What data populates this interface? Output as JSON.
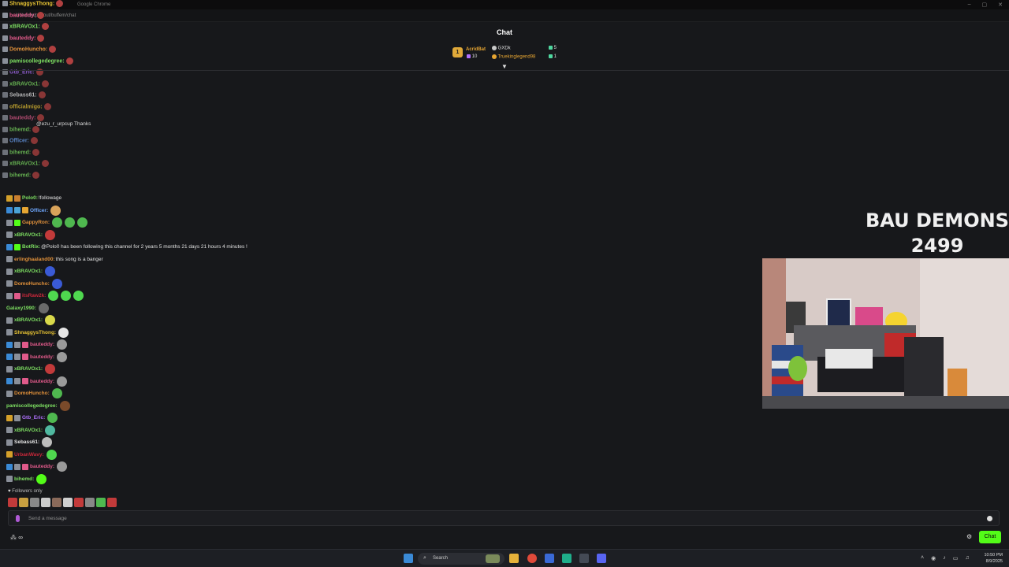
{
  "browser": {
    "app_title": "Google Chrome",
    "url": "kick.com/popout/buffem/chat"
  },
  "chat_header": {
    "title": "Chat",
    "top_gifter_rank": "1",
    "gifters": [
      {
        "name": "AcridBat",
        "count": "10",
        "color": "#e6a532"
      },
      {
        "name": "GXDk",
        "count": "5",
        "color": "#c8c8c8"
      },
      {
        "name": "Truekinglegend98",
        "count": "1",
        "color": "#e6a532"
      }
    ]
  },
  "ghost_messages": [
    {
      "name": "ShnaggysThong:",
      "color": "#e6c233"
    },
    {
      "name": "bauteddy:",
      "color": "#e05a8a"
    },
    {
      "name": "xBRAVOx1:",
      "color": "#7ee062"
    },
    {
      "name": "bauteddy:",
      "color": "#e05a8a"
    },
    {
      "name": "DomoHuncho:",
      "color": "#e0903a"
    },
    {
      "name": "pamiscollegedegree:",
      "color": "#7ee062"
    },
    {
      "name": "Gtb_Eric:",
      "color": "#b070ff"
    },
    {
      "name": "xBRAVOx1:",
      "color": "#7ee062"
    },
    {
      "name": "Sebass61:",
      "color": "#e6e6e6"
    },
    {
      "name": "officialmigo:",
      "color": "#e6c233"
    },
    {
      "name": "bauteddy:",
      "color": "#e05a8a"
    },
    {
      "name": "bihemd:",
      "color": "#7ee062"
    },
    {
      "name": "Officer:",
      "color": "#6fa8ff"
    },
    {
      "name": "bihemd:",
      "color": "#7ee062"
    },
    {
      "name": "xBRAVOx1:",
      "color": "#7ee062"
    },
    {
      "name": "bihemd:",
      "color": "#7ee062"
    }
  ],
  "ghost_thanks": "@ezu_r_urpcup Thanks",
  "messages": [
    {
      "badges": [
        "#d4a02a",
        "#c97f2f"
      ],
      "name": "Polo0:",
      "color": "#7ee062",
      "text": "!followage",
      "emotes": []
    },
    {
      "badges": [
        "#3a8ad6",
        "#4ba3d6",
        "#e6a532"
      ],
      "name": "Officer:",
      "color": "#6fa8ff",
      "text": "",
      "emotes": [
        "#d9a35a"
      ]
    },
    {
      "badges": [
        "#8a8f99",
        "#53fc18"
      ],
      "name": "GappyRon:",
      "color": "#e0903a",
      "text": "",
      "emotes": [
        "#4fb84f",
        "#4fb84f",
        "#4fb84f"
      ]
    },
    {
      "badges": [
        "#8a8f99"
      ],
      "name": "xBRAVOx1:",
      "color": "#7ee062",
      "text": "",
      "emotes": [
        "#c23a3a"
      ]
    },
    {
      "badges": [
        "#3a8ad6",
        "#53fc18"
      ],
      "name": "BotRix:",
      "color": "#7ee062",
      "text": "@Polo0 has been following this channel for 2 years 5 months 21 days 21 hours 4 minutes !",
      "emotes": []
    },
    {
      "badges": [
        "#8a8f99"
      ],
      "name": "erlinghaaland00:",
      "color": "#e0903a",
      "text": "this song is a banger",
      "emotes": []
    },
    {
      "badges": [
        "#8a8f99"
      ],
      "name": "xBRAVOx1:",
      "color": "#7ee062",
      "text": "",
      "emotes": [
        "#3a5ad6"
      ]
    },
    {
      "badges": [
        "#8a8f99"
      ],
      "name": "DomoHuncho:",
      "color": "#e0903a",
      "text": "",
      "emotes": [
        "#3a5ad6"
      ]
    },
    {
      "badges": [
        "#8a8f99",
        "#e05a8a"
      ],
      "name": "itsRaw2k:",
      "color": "#c9283a",
      "text": "",
      "emotes": [
        "#4fd84f",
        "#4fd84f",
        "#4fd84f"
      ]
    },
    {
      "badges": [],
      "name": "Galaxy1990:",
      "color": "#7ee062",
      "text": "",
      "emotes": [
        "#6a6a6a"
      ]
    },
    {
      "badges": [
        "#8a8f99"
      ],
      "name": "xBRAVOx1:",
      "color": "#7ee062",
      "text": "",
      "emotes": [
        "#d9d94a"
      ]
    },
    {
      "badges": [
        "#8a8f99"
      ],
      "name": "ShnaggysThong:",
      "color": "#e6c233",
      "text": "",
      "emotes": [
        "#e6e6e6"
      ]
    },
    {
      "badges": [
        "#3a8ad6",
        "#8a8f99",
        "#e05a8a"
      ],
      "name": "bauteddy:",
      "color": "#e05a8a",
      "text": "",
      "emotes": [
        "#9a9a9a"
      ]
    },
    {
      "badges": [
        "#3a8ad6",
        "#8a8f99",
        "#e05a8a"
      ],
      "name": "bauteddy:",
      "color": "#e05a8a",
      "text": "",
      "emotes": [
        "#9a9a9a"
      ]
    },
    {
      "badges": [
        "#8a8f99"
      ],
      "name": "xBRAVOx1:",
      "color": "#7ee062",
      "text": "",
      "emotes": [
        "#c23a3a"
      ]
    },
    {
      "badges": [
        "#3a8ad6",
        "#8a8f99",
        "#e05a8a"
      ],
      "name": "bauteddy:",
      "color": "#e05a8a",
      "text": "",
      "emotes": [
        "#9a9a9a"
      ]
    },
    {
      "badges": [
        "#8a8f99"
      ],
      "name": "DomoHuncho:",
      "color": "#e0903a",
      "text": "",
      "emotes": [
        "#4fb84f"
      ]
    },
    {
      "badges": [],
      "name": "pamiscollegedegree:",
      "color": "#7ee062",
      "text": "",
      "emotes": [
        "#7a4a2a"
      ]
    },
    {
      "badges": [
        "#d4a02a",
        "#8a8f99"
      ],
      "name": "Gtb_Eric:",
      "color": "#b070ff",
      "text": "",
      "emotes": [
        "#4fb84f"
      ]
    },
    {
      "badges": [
        "#8a8f99"
      ],
      "name": "xBRAVOx1:",
      "color": "#7ee062",
      "text": "",
      "emotes": [
        "#4fb8a0"
      ]
    },
    {
      "badges": [
        "#8a8f99"
      ],
      "name": "Sebass61:",
      "color": "#e6e6e6",
      "text": "",
      "emotes": [
        "#bdbdbd"
      ]
    },
    {
      "badges": [
        "#d4a02a"
      ],
      "name": "UrbanWavy:",
      "color": "#c9283a",
      "text": "",
      "emotes": [
        "#4fd84f"
      ]
    },
    {
      "badges": [
        "#3a8ad6",
        "#8a8f99",
        "#e05a8a"
      ],
      "name": "bauteddy:",
      "color": "#e05a8a",
      "text": "",
      "emotes": [
        "#9a9a9a"
      ]
    },
    {
      "badges": [
        "#8a8f99"
      ],
      "name": "bihemd:",
      "color": "#7ee062",
      "text": "",
      "emotes": [
        "#53fc18"
      ]
    }
  ],
  "followers_only": "Followers only",
  "emote_bar_colors": [
    "#c23a3a",
    "#c9a040",
    "#888888",
    "#cccccc",
    "#8a6a5a",
    "#d0d0d0",
    "#c23a3a",
    "#888888",
    "#4fb84f",
    "#c23a3a"
  ],
  "input": {
    "placeholder": "Send a message"
  },
  "bottom": {
    "left_icon": "∞",
    "chat_button": "Chat"
  },
  "overlay": {
    "line1": "BAU DEMONS",
    "line2": "2499"
  },
  "taskbar": {
    "search_label": "Search",
    "time": "10:50 PM",
    "date": "8/9/2025"
  }
}
